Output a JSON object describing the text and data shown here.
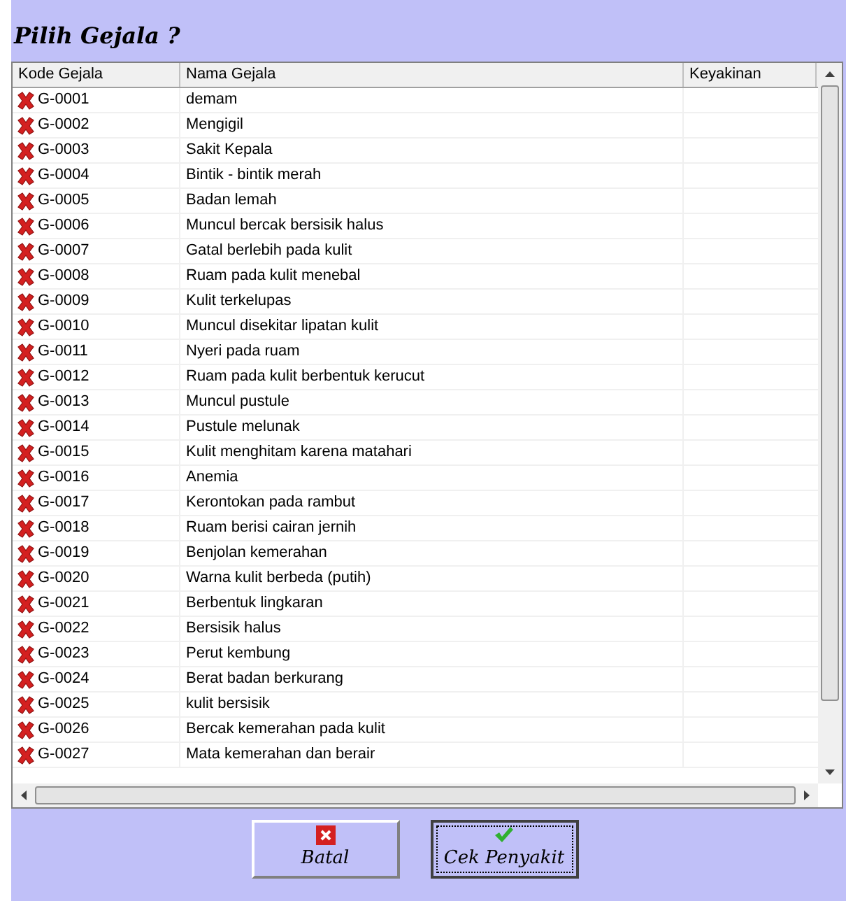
{
  "title": "Pilih Gejala ?",
  "table": {
    "columns": [
      "Kode Gejala",
      "Nama Gejala",
      "Keyakinan"
    ],
    "rows": [
      {
        "code": "G-0001",
        "name": "demam",
        "checked": false
      },
      {
        "code": "G-0002",
        "name": "Mengigil",
        "checked": false
      },
      {
        "code": "G-0003",
        "name": "Sakit Kepala",
        "checked": false
      },
      {
        "code": "G-0004",
        "name": "Bintik - bintik merah",
        "checked": false
      },
      {
        "code": "G-0005",
        "name": "Badan lemah",
        "checked": false
      },
      {
        "code": "G-0006",
        "name": "Muncul bercak bersisik halus",
        "checked": false
      },
      {
        "code": "G-0007",
        "name": "Gatal berlebih pada kulit",
        "checked": false
      },
      {
        "code": "G-0008",
        "name": "Ruam pada kulit menebal",
        "checked": false
      },
      {
        "code": "G-0009",
        "name": "Kulit terkelupas",
        "checked": false
      },
      {
        "code": "G-0010",
        "name": "Muncul disekitar lipatan kulit",
        "checked": false
      },
      {
        "code": "G-0011",
        "name": "Nyeri pada ruam",
        "checked": false
      },
      {
        "code": "G-0012",
        "name": "Ruam pada kulit berbentuk kerucut",
        "checked": false
      },
      {
        "code": "G-0013",
        "name": "Muncul pustule",
        "checked": false
      },
      {
        "code": "G-0014",
        "name": "Pustule melunak",
        "checked": false
      },
      {
        "code": "G-0015",
        "name": "Kulit menghitam karena matahari",
        "checked": false
      },
      {
        "code": "G-0016",
        "name": "Anemia",
        "checked": false
      },
      {
        "code": "G-0017",
        "name": "Kerontokan pada rambut",
        "checked": false
      },
      {
        "code": "G-0018",
        "name": "Ruam berisi cairan jernih",
        "checked": false
      },
      {
        "code": "G-0019",
        "name": "Benjolan kemerahan",
        "checked": false
      },
      {
        "code": "G-0020",
        "name": "Warna kulit berbeda (putih)",
        "checked": false
      },
      {
        "code": "G-0021",
        "name": "Berbentuk lingkaran",
        "checked": false
      },
      {
        "code": "G-0022",
        "name": "Bersisik halus",
        "checked": false
      },
      {
        "code": "G-0023",
        "name": "Perut kembung",
        "checked": false
      },
      {
        "code": "G-0024",
        "name": "Berat badan berkurang",
        "checked": false
      },
      {
        "code": "G-0025",
        "name": "kulit bersisik",
        "checked": false
      },
      {
        "code": "G-0026",
        "name": "Bercak kemerahan pada kulit",
        "checked": false
      },
      {
        "code": "G-0027",
        "name": "Mata kemerahan dan berair",
        "checked": false
      }
    ]
  },
  "buttons": [
    {
      "label": "Batal",
      "kind": "cancel",
      "focused": false
    },
    {
      "label": "Cek Penyakit",
      "kind": "ok",
      "focused": true
    }
  ]
}
